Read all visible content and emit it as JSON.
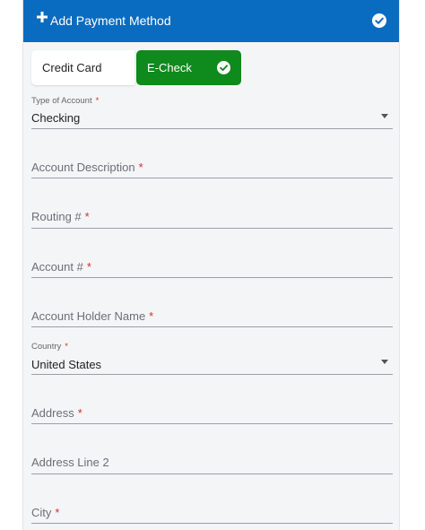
{
  "header": {
    "title": "Add Payment Method",
    "accent_color": "#0a6cc0",
    "icons": [
      "plus-icon",
      "check-circle-icon"
    ]
  },
  "payment_type": {
    "options": [
      {
        "label": "Credit Card",
        "selected": false
      },
      {
        "label": "E-Check",
        "selected": true
      }
    ],
    "selected_color": "#0f8a1c"
  },
  "form": {
    "required_marker": "*",
    "account_type": {
      "label": "Type of Account",
      "value": "Checking"
    },
    "account_description": {
      "placeholder": "Account Description"
    },
    "routing": {
      "placeholder": "Routing #"
    },
    "account_number": {
      "placeholder": "Account #"
    },
    "holder_name": {
      "placeholder": "Account Holder Name"
    },
    "country": {
      "label": "Country",
      "value": "United States"
    },
    "address": {
      "placeholder": "Address"
    },
    "address2": {
      "placeholder": "Address Line 2"
    },
    "city": {
      "placeholder": "City"
    }
  }
}
